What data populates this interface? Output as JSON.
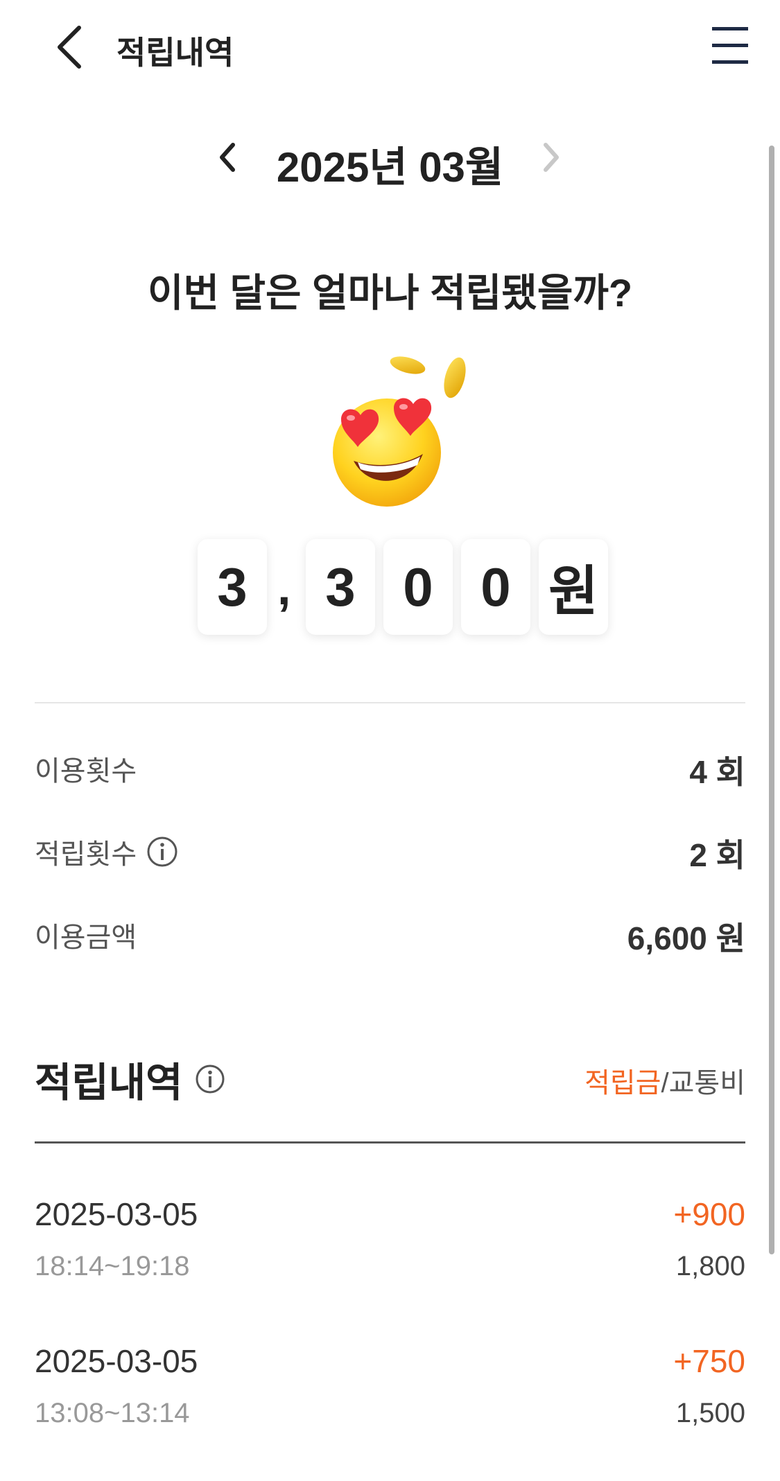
{
  "header": {
    "title": "적립내역"
  },
  "month_nav": {
    "label": "2025년 03월"
  },
  "summary": {
    "question": "이번 달은 얼마나 적립됐을까?",
    "amount_digits": [
      "3",
      ",",
      "3",
      "0",
      "0",
      "원"
    ]
  },
  "stats": [
    {
      "label": "이용횟수",
      "value": "4 회"
    },
    {
      "label": "적립횟수",
      "value": "2 회"
    },
    {
      "label": "이용금액",
      "value": "6,600 원"
    }
  ],
  "history": {
    "title": "적립내역",
    "toggle_active": "적립금",
    "toggle_sep": "/",
    "toggle_inactive": "교통비",
    "entries": [
      {
        "date": "2025-03-05",
        "time": "18:14~19:18",
        "points": "+900",
        "fare": "1,800"
      },
      {
        "date": "2025-03-05",
        "time": "13:08~13:14",
        "points": "+750",
        "fare": "1,500"
      }
    ]
  },
  "colors": {
    "accent": "#f26522",
    "text": "#222222",
    "muted": "#999999"
  },
  "icons": {
    "back": "chevron-left-icon",
    "menu": "hamburger-menu-icon",
    "info": "info-icon",
    "emoji": "heart-eyes-emoji"
  }
}
